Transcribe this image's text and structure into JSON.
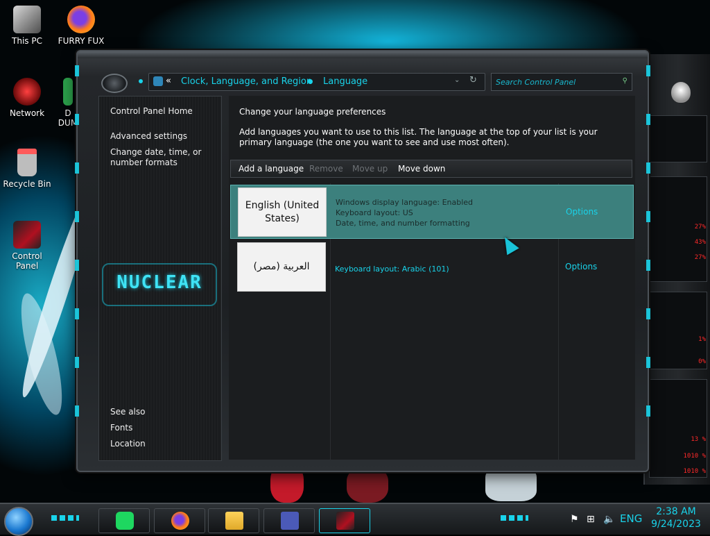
{
  "desktop": {
    "icons": [
      {
        "label": "This PC",
        "icon": "computer-icon"
      },
      {
        "label": "FURRY FUX",
        "icon": "firefox-icon"
      },
      {
        "label": "Network",
        "icon": "network-icon"
      },
      {
        "label": "D DUM",
        "icon": "app-icon"
      },
      {
        "label": "Recycle Bin",
        "icon": "recycle-bin-icon"
      },
      {
        "label": "Control Panel",
        "icon": "control-panel-icon"
      }
    ]
  },
  "window": {
    "breadcrumb": {
      "chevron": "«",
      "items": [
        "Clock, Language, and Region",
        "Language"
      ]
    },
    "search": {
      "placeholder": "Search Control Panel"
    },
    "left_nav": {
      "home": "Control Panel Home",
      "links": [
        "Advanced settings",
        "Change date, time, or number formats"
      ],
      "logo_text": "NUCLEAR",
      "see_also": {
        "heading": "See also",
        "links": [
          "Fonts",
          "Location"
        ]
      }
    },
    "content": {
      "title": "Change your language preferences",
      "description": "Add languages you want to use to this list. The language at the top of your list is your primary language (the one you want to see and use most often).",
      "toolbar": {
        "add": "Add a language",
        "remove": "Remove",
        "move_up": "Move up",
        "move_down": "Move down"
      },
      "languages": [
        {
          "name": "English (United States)",
          "details": [
            "Windows display language: Enabled",
            "Keyboard layout: US",
            "Date, time, and number formatting"
          ],
          "options": "Options",
          "selected": true
        },
        {
          "name": "العربية (مصر)",
          "details": [
            "Keyboard layout: Arabic (101)"
          ],
          "options": "Options",
          "selected": false
        }
      ]
    }
  },
  "gadget": {
    "readouts": [
      "27%",
      "43%",
      "27%",
      "1%",
      "0%",
      "13 %",
      "1010 %",
      "1010 %"
    ]
  },
  "taskbar": {
    "apps": [
      "spotify-icon",
      "firefox-icon",
      "file-explorer-icon",
      "window-icon",
      "control-panel-icon"
    ],
    "language": "ENG",
    "time": "2:38 AM",
    "date": "9/24/2023"
  },
  "colors": {
    "accent": "#19d3ea",
    "selection": "#3c807d",
    "gadget_text": "#ff2a2a"
  }
}
